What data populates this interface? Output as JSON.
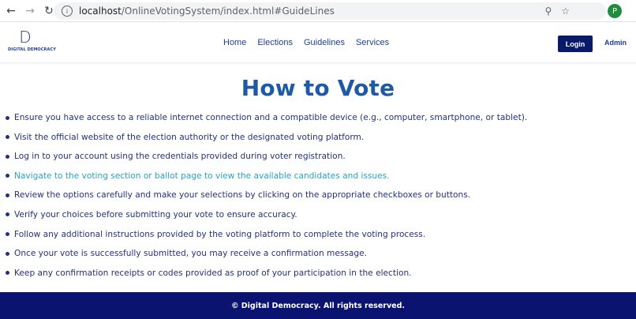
{
  "browser": {
    "url_host": "localhost",
    "url_path": "/OnlineVotingSystem/index.html#GuideLines",
    "profile_initial": "P"
  },
  "header": {
    "logo_letter": "D",
    "logo_text": "DIGITAL DEMOCRACY",
    "nav": [
      "Home",
      "Elections",
      "Guidelines",
      "Services"
    ],
    "login_label": "Login",
    "admin_label": "Admin"
  },
  "main": {
    "title": "How to Vote",
    "guidelines": [
      "Ensure you have access to a reliable internet connection and a compatible device (e.g., computer, smartphone, or tablet).",
      "Visit the official website of the election authority or the designated voting platform.",
      "Log in to your account using the credentials provided during voter registration.",
      "Navigate to the voting section or ballot page to view the available candidates and issues.",
      "Review the options carefully and make your selections by clicking on the appropriate checkboxes or buttons.",
      "Verify your choices before submitting your vote to ensure accuracy.",
      "Follow any additional instructions provided by the voting platform to complete the voting process.",
      "Once your vote is successfully submitted, you may receive a confirmation message.",
      "Keep any confirmation receipts or codes provided as proof of your participation in the election."
    ]
  },
  "footer": {
    "text": "© Digital Democracy. All rights reserved."
  },
  "colors": {
    "brand_dark": "#0a1470",
    "title_blue": "#1f5aa6",
    "text_navy": "#22317f",
    "hover_cyan": "#24a3c6"
  }
}
